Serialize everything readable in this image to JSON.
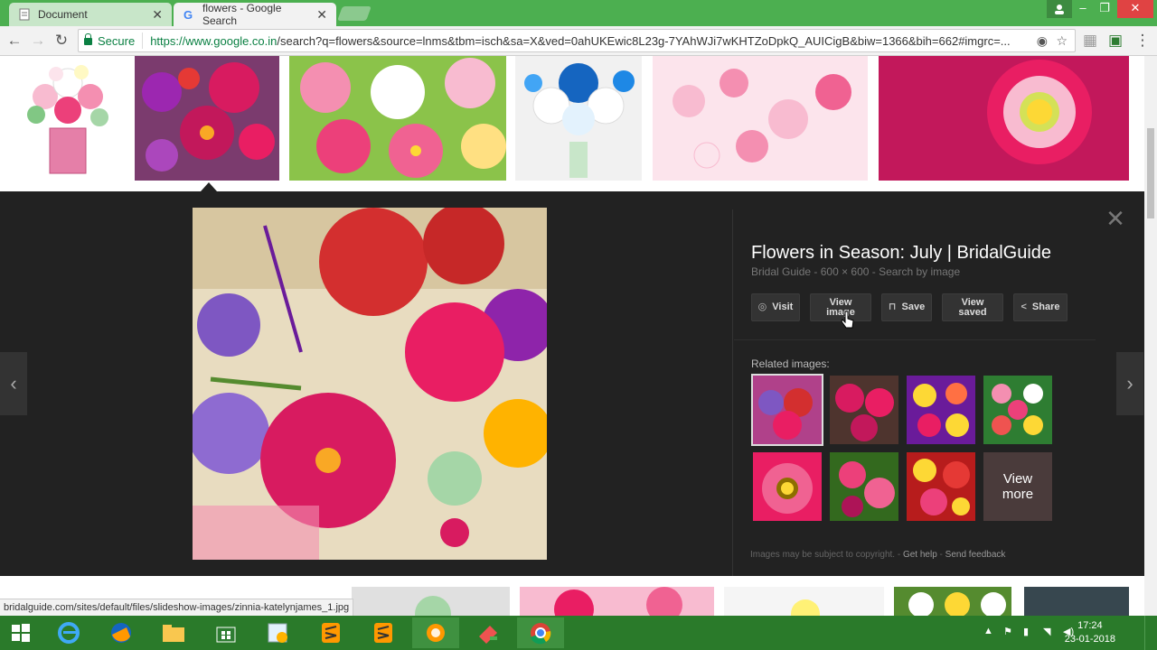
{
  "tabs": [
    {
      "title": "Document",
      "close": "✕"
    },
    {
      "title": "flowers - Google Search",
      "close": "✕"
    }
  ],
  "toolbar": {
    "secure_label": "Secure",
    "url_host": "https://www.google.co.in",
    "url_rest": "/search?q=flowers&source=lnms&tbm=isch&sa=X&ved=0ahUKEwic8L23g-7YAhWJi7wKHTZoDpkQ_AUICigB&biw=1366&bih=662#imgrc=..."
  },
  "preview": {
    "title": "Flowers in Season: July | BridalGuide",
    "source": "Bridal Guide",
    "dimensions": "600 × 600",
    "search_by_image": "Search by image",
    "actions": {
      "visit": "Visit",
      "view_image": "View image",
      "save": "Save",
      "view_saved": "View saved",
      "share": "Share"
    },
    "related_label": "Related images:",
    "view_more": "View more",
    "footer_note": "Images may be subject to copyright.",
    "get_help": "Get help",
    "send_feedback": "Send feedback",
    "close": "✕"
  },
  "status_url": "bridalguide.com/sites/default/files/slideshow-images/zinnia-katelynjames_1.jpg",
  "clock": {
    "time": "17:24",
    "date": "23-01-2018"
  },
  "colors": {
    "tabstrip": "#4caf50",
    "taskbar": "#2a7a2a",
    "panel": "#222222"
  }
}
